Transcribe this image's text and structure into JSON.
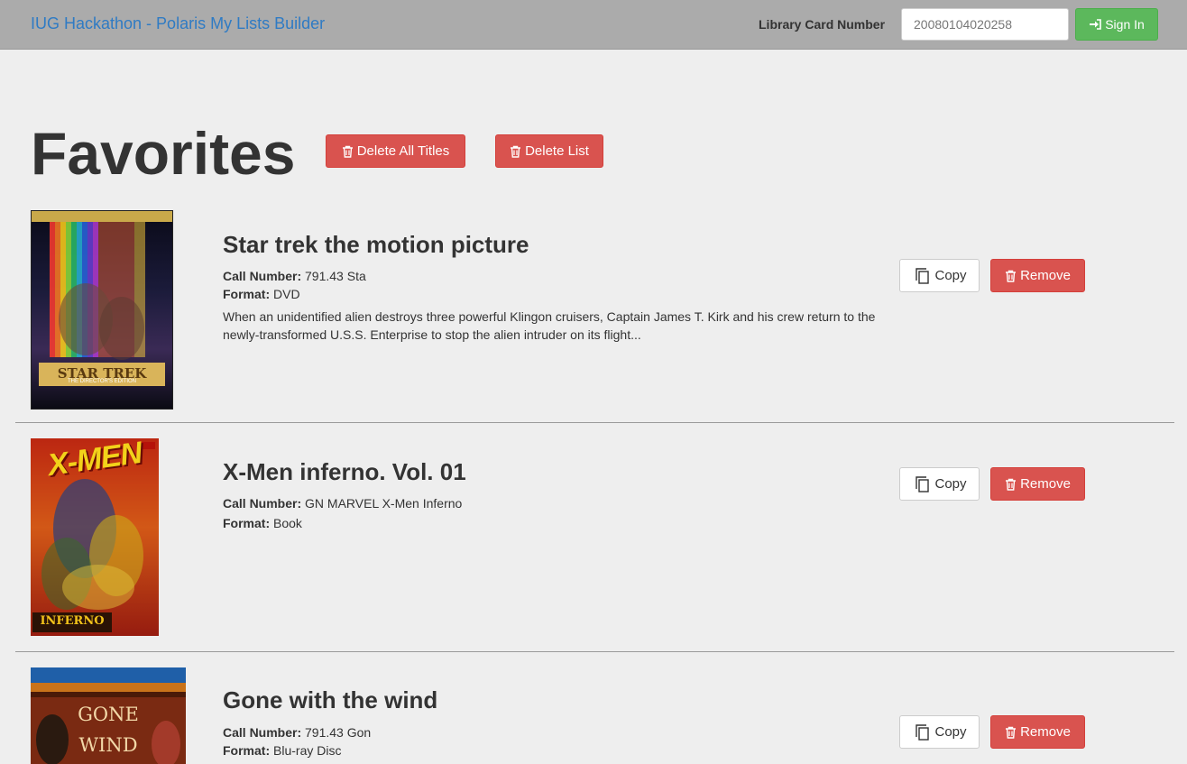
{
  "navbar": {
    "brand": "IUG Hackathon - Polaris My Lists Builder",
    "card_label": "Library Card Number",
    "card_value": "20080104020258",
    "signin_label": "Sign In",
    "signin_icon": "sign-in-icon"
  },
  "list": {
    "title": "Favorites",
    "delete_all_label": "Delete All Titles",
    "delete_list_label": "Delete List"
  },
  "items": [
    {
      "title": "Star trek the motion picture",
      "call_number_label": "Call Number:",
      "call_number": "791.43 Sta",
      "format_label": "Format:",
      "format": "DVD",
      "summary": "When an unidentified alien destroys three powerful Klingon cruisers, Captain James T. Kirk and his crew return to the newly-transformed U.S.S. Enterprise to stop the alien intruder on its flight...",
      "cover_text": "STAR TREK",
      "cover_subtext": "THE DIRECTOR'S EDITION",
      "copy_label": "Copy",
      "remove_label": "Remove"
    },
    {
      "title": "X-Men inferno. Vol. 01",
      "call_number_label": "Call Number:",
      "call_number": "GN MARVEL X-Men Inferno",
      "format_label": "Format:",
      "format": "Book",
      "cover_text": "X-MEN",
      "cover_subtext": "INFERNO",
      "copy_label": "Copy",
      "remove_label": "Remove"
    },
    {
      "title": "Gone with the wind",
      "call_number_label": "Call Number:",
      "call_number": "791.43 Gon",
      "format_label": "Format:",
      "format": "Blu-ray Disc",
      "cover_text": "GONE",
      "cover_subtext": "WIND",
      "copy_label": "Copy",
      "remove_label": "Remove"
    }
  ],
  "colors": {
    "navbar_bg": "#ababab",
    "brand": "#2f7bc4",
    "success": "#5cb85c",
    "danger": "#d9534f",
    "page_bg": "#eeeeee"
  }
}
